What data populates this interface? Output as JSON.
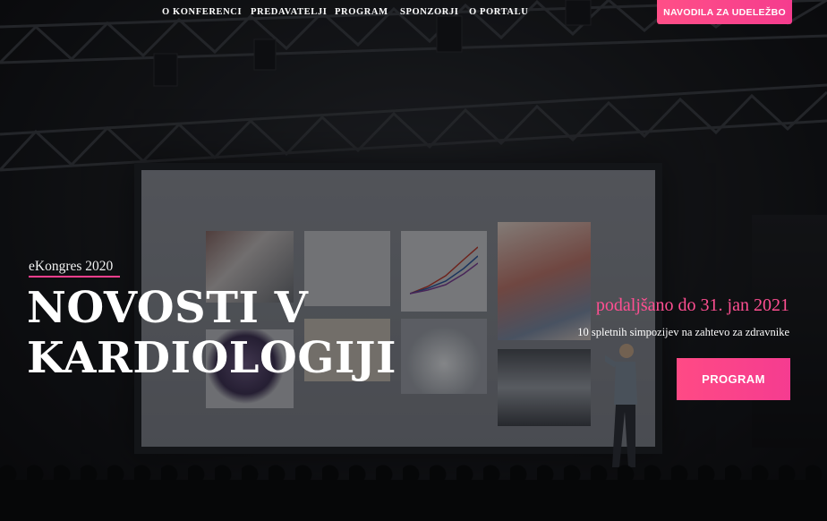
{
  "nav": {
    "items": [
      {
        "label": "O KONFERENCI"
      },
      {
        "label": "PREDAVATELJI"
      },
      {
        "label": "PROGRAM"
      },
      {
        "label": "SPONZORJI"
      },
      {
        "label": "O PORTALU"
      }
    ],
    "cta_label": "NAVODILA ZA UDELEŽBO"
  },
  "hero": {
    "eyebrow": "eKongres 2020",
    "title_line1": "NOVOSTI V",
    "title_line2": "KARDIOLOGIJI",
    "extended_text": "podaljšano do 31. jan 2021",
    "subline": "10 spletnih simpozijev na zahtevo za zdravnike",
    "program_button": "PROGRAM"
  },
  "colors": {
    "accent": "#f53c8e",
    "text": "#ffffff"
  }
}
